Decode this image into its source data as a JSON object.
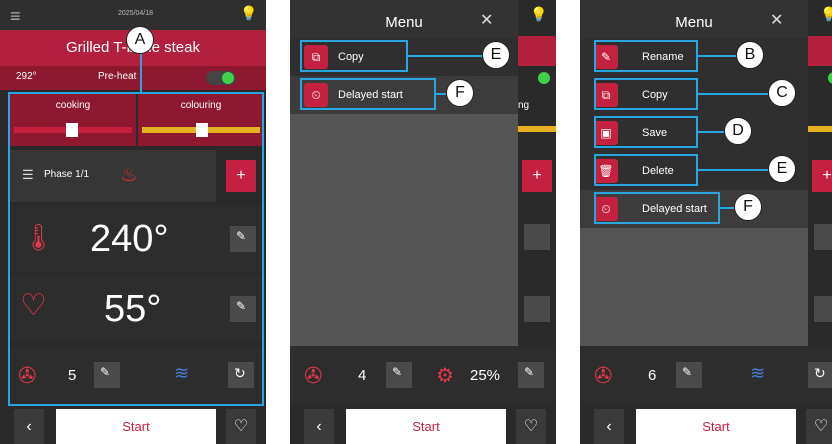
{
  "p1": {
    "date": "2025/04/18",
    "title": "Grilled T-bone steak",
    "temp_small": "292°",
    "preheat": "Pre-heat",
    "cooking": "cooking",
    "colouring": "colouring",
    "phase": "Phase 1/1",
    "temp_big": "240°",
    "core_temp": "55°",
    "fan": "5",
    "start": "Start",
    "callout_a": "A"
  },
  "p2": {
    "menu_title": "Menu",
    "copy": "Copy",
    "delayed": "Delayed start",
    "fan": "4",
    "percent": "25%",
    "start": "Start",
    "partial_text": "ng",
    "callout_e": "E",
    "callout_f": "F"
  },
  "p3": {
    "menu_title": "Menu",
    "rename": "Rename",
    "copy": "Copy",
    "save": "Save",
    "delete": "Delete",
    "delayed": "Delayed start",
    "fan": "6",
    "start": "Start",
    "callout_b": "B",
    "callout_c": "C",
    "callout_d": "D",
    "callout_e": "E",
    "callout_f": "F"
  },
  "colors": {
    "brand_red": "#c3213f",
    "highlight_blue": "#29a6de",
    "toggle_green": "#3fd14a"
  },
  "icons": [
    "hamburger-icon",
    "lightbulb-icon",
    "close-icon",
    "thermometer-icon",
    "heart-probe-icon",
    "fan-icon",
    "edit-icon",
    "copy-icon",
    "delayed-start-icon",
    "rename-icon",
    "save-icon",
    "delete-icon",
    "heat-icon",
    "steam-icon",
    "refresh-icon",
    "heart-favorite-icon",
    "chevron-left-icon",
    "list-icon"
  ]
}
